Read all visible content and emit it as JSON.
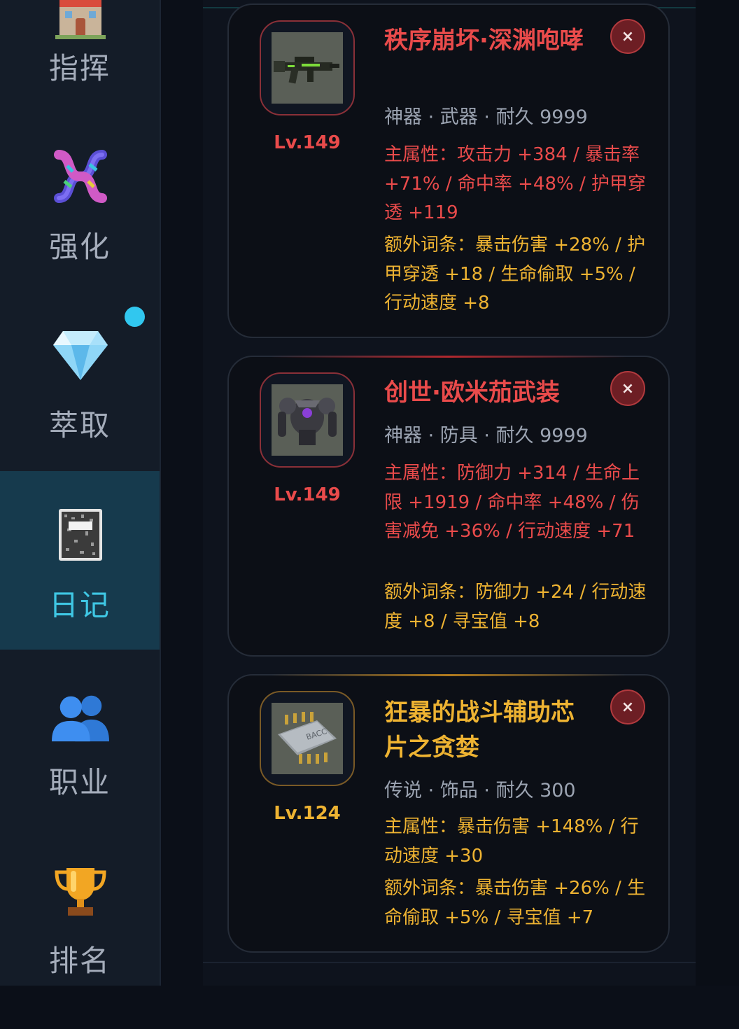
{
  "sidebar": {
    "items": [
      {
        "label": "指挥",
        "icon": "building-icon"
      },
      {
        "label": "强化",
        "icon": "dna-icon"
      },
      {
        "label": "萃取",
        "icon": "gem-icon"
      },
      {
        "label": "日记",
        "icon": "notebook-icon"
      },
      {
        "label": "职业",
        "icon": "users-icon"
      },
      {
        "label": "排名",
        "icon": "trophy-icon"
      }
    ],
    "active_index": 3,
    "accent_color": "#3fc7e4"
  },
  "items": [
    {
      "title": "秩序崩坏·深渊咆哮",
      "level": "Lv.149",
      "meta": "神器 · 武器 · 耐久 9999",
      "main_stats": "主属性：攻击力 +384 / 暴击率 +71% / 命中率 +48% / 护甲穿透 +119",
      "extra_stats": "额外词条：暴击伤害 +28% / 护甲穿透 +18 / 生命偷取 +5% / 行动速度 +8",
      "rarity_color": "#ea4b4b",
      "icon": "rifle-icon",
      "close_label": "×"
    },
    {
      "title": "创世·欧米茄武装",
      "level": "Lv.149",
      "meta": "神器 · 防具 · 耐久 9999",
      "main_stats": "主属性：防御力 +314 / 生命上限 +1919 / 命中率 +48% / 伤害减免 +36% / 行动速度 +71",
      "extra_stats": "额外词条：防御力 +24 / 行动速度 +8 / 寻宝值 +8",
      "rarity_color": "#ea4b4b",
      "icon": "mech-armor-icon",
      "close_label": "×"
    },
    {
      "title": "狂暴的战斗辅助芯片之贪婪",
      "level": "Lv.124",
      "meta": "传说 · 饰品 · 耐久 300",
      "main_stats": "主属性：暴击伤害 +148% / 行动速度 +30",
      "extra_stats": "额外词条：暴击伤害 +26% / 生命偷取 +5% / 寻宝值 +7",
      "rarity_color": "#eeb332",
      "icon": "chip-icon",
      "chip_text": "BACC",
      "close_label": "×"
    }
  ]
}
